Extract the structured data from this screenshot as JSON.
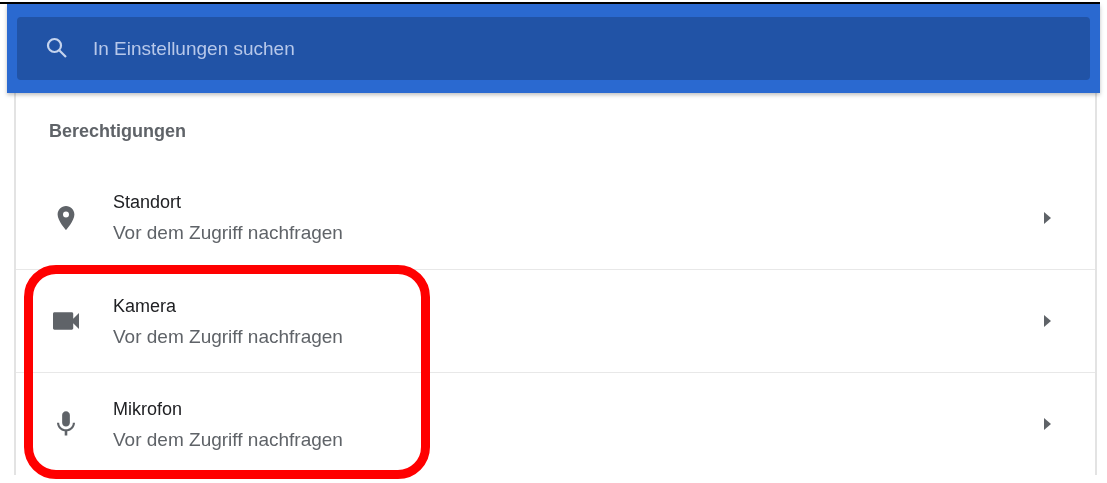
{
  "search": {
    "placeholder": "In Einstellungen suchen"
  },
  "section": {
    "title": "Berechtigungen"
  },
  "rows": [
    {
      "kind": "location",
      "title": "Standort",
      "subtitle": "Vor dem Zugriff nachfragen",
      "highlighted": false
    },
    {
      "kind": "camera",
      "title": "Kamera",
      "subtitle": "Vor dem Zugriff nachfragen",
      "highlighted": true
    },
    {
      "kind": "microphone",
      "title": "Mikrofon",
      "subtitle": "Vor dem Zugriff nachfragen",
      "highlighted": true
    }
  ]
}
